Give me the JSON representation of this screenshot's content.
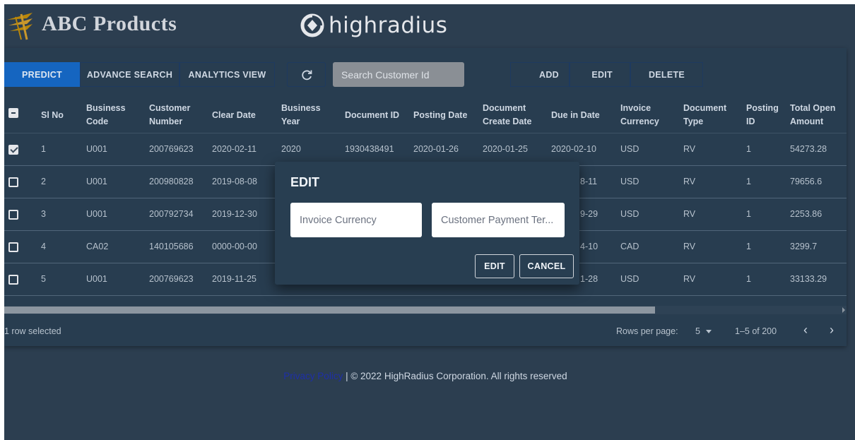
{
  "brand": {
    "name": "ABC Products",
    "partner": "highradius"
  },
  "toolbar": {
    "predict": "PREDICT",
    "advance_search": "ADVANCE SEARCH",
    "analytics_view": "ANALYTICS VIEW",
    "refresh_icon": "refresh-icon",
    "search_placeholder": "Search Customer Id",
    "add": "ADD",
    "edit": "EDIT",
    "delete": "DELETE"
  },
  "table": {
    "headers": [
      "Sl No",
      "Business Code",
      "Customer Number",
      "Clear Date",
      "Business Year",
      "Document ID",
      "Posting Date",
      "Document Create Date",
      "Due in Date",
      "Invoice Currency",
      "Document Type",
      "Posting ID",
      "Total Open Amount"
    ],
    "header_lines": {
      "business_code": [
        "Business",
        "Code"
      ],
      "customer_number": [
        "Customer",
        "Number"
      ],
      "business_year": [
        "Business",
        "Year"
      ],
      "document_create_date": [
        "Document",
        "Create Date"
      ],
      "invoice_currency": [
        "Invoice",
        "Currency"
      ],
      "document_type": [
        "Document",
        "Type"
      ],
      "posting_id": [
        "Posting",
        "ID"
      ],
      "total_open_amount": [
        "Total Open",
        "Amount"
      ]
    },
    "rows": [
      {
        "checked": true,
        "sl": "1",
        "business_code": "U001",
        "customer_number": "200769623",
        "clear_date": "2020-02-11",
        "business_year": "2020",
        "document_id": "1930438491",
        "posting_date": "2020-01-26",
        "document_create_date": "2020-01-25",
        "due_in_date": "2020-02-10",
        "invoice_currency": "USD",
        "document_type": "RV",
        "posting_id": "1",
        "total_open_amount": "54273.28"
      },
      {
        "checked": false,
        "sl": "2",
        "business_code": "U001",
        "customer_number": "200980828",
        "clear_date": "2019-08-08",
        "due_in_date_visible": "8-11",
        "invoice_currency": "USD",
        "document_type": "RV",
        "posting_id": "1",
        "total_open_amount": "79656.6"
      },
      {
        "checked": false,
        "sl": "3",
        "business_code": "U001",
        "customer_number": "200792734",
        "clear_date": "2019-12-30",
        "due_in_date_visible": "9-29",
        "invoice_currency": "USD",
        "document_type": "RV",
        "posting_id": "1",
        "total_open_amount": "2253.86"
      },
      {
        "checked": false,
        "sl": "4",
        "business_code": "CA02",
        "customer_number": "140105686",
        "clear_date": "0000-00-00",
        "due_in_date_visible": "4-10",
        "invoice_currency": "CAD",
        "document_type": "RV",
        "posting_id": "1",
        "total_open_amount": "3299.7"
      },
      {
        "checked": false,
        "sl": "5",
        "business_code": "U001",
        "customer_number": "200769623",
        "clear_date": "2019-11-25",
        "due_in_date_visible": "1-28",
        "invoice_currency": "USD",
        "document_type": "RV",
        "posting_id": "1",
        "total_open_amount": "33133.29"
      }
    ]
  },
  "grid_footer": {
    "selected": "1 row selected",
    "rows_per_page_label": "Rows per page:",
    "rows_per_page_value": "5",
    "range": "1–5 of 200",
    "prev": "‹",
    "next": "›"
  },
  "page_footer": {
    "link": "Privacy Policy",
    "text": " | © 2022 HighRadius Corporation. All rights reserved"
  },
  "modal": {
    "title": "EDIT",
    "field1_placeholder": "Invoice Currency",
    "field2_placeholder": "Customer Payment Ter...",
    "edit": "EDIT",
    "cancel": "CANCEL"
  }
}
